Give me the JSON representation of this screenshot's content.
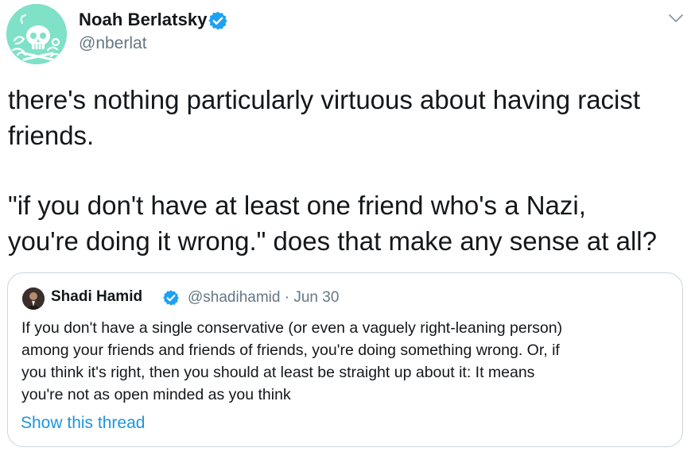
{
  "author": {
    "display_name": "Noah Berlatsky",
    "handle": "@nberlat",
    "verified": true,
    "avatar_icon": "skull-illustration-icon"
  },
  "tweet": {
    "paragraphs": [
      [
        "there's nothing particularly virtuous about having racist",
        "friends."
      ],
      [
        "\"if you don't have at least one friend who's a Nazi,",
        "you're doing it wrong.\" does that make any sense at all?"
      ]
    ]
  },
  "quoted_tweet": {
    "display_name": "Shadi Hamid",
    "verified": true,
    "handle_date": "@shadihamid · Jun 30",
    "text_lines": [
      "If you don't have a single conservative (or even a vaguely right-leaning person)",
      "among your friends and friends of friends, you're doing something wrong. Or, if",
      "you think it's right, then you should at least be straight up about it: It means",
      "you're not as open minded as you think"
    ],
    "show_thread_label": "Show this thread"
  },
  "colors": {
    "link": "#1b95e0",
    "secondary_text": "#657786",
    "verified_badge": "#1da1f2",
    "avatar_bg": "#7fe1c7",
    "border": "#ccd6dd"
  },
  "icons": {
    "verified": "verified-badge-icon",
    "menu": "chevron-down-icon"
  }
}
